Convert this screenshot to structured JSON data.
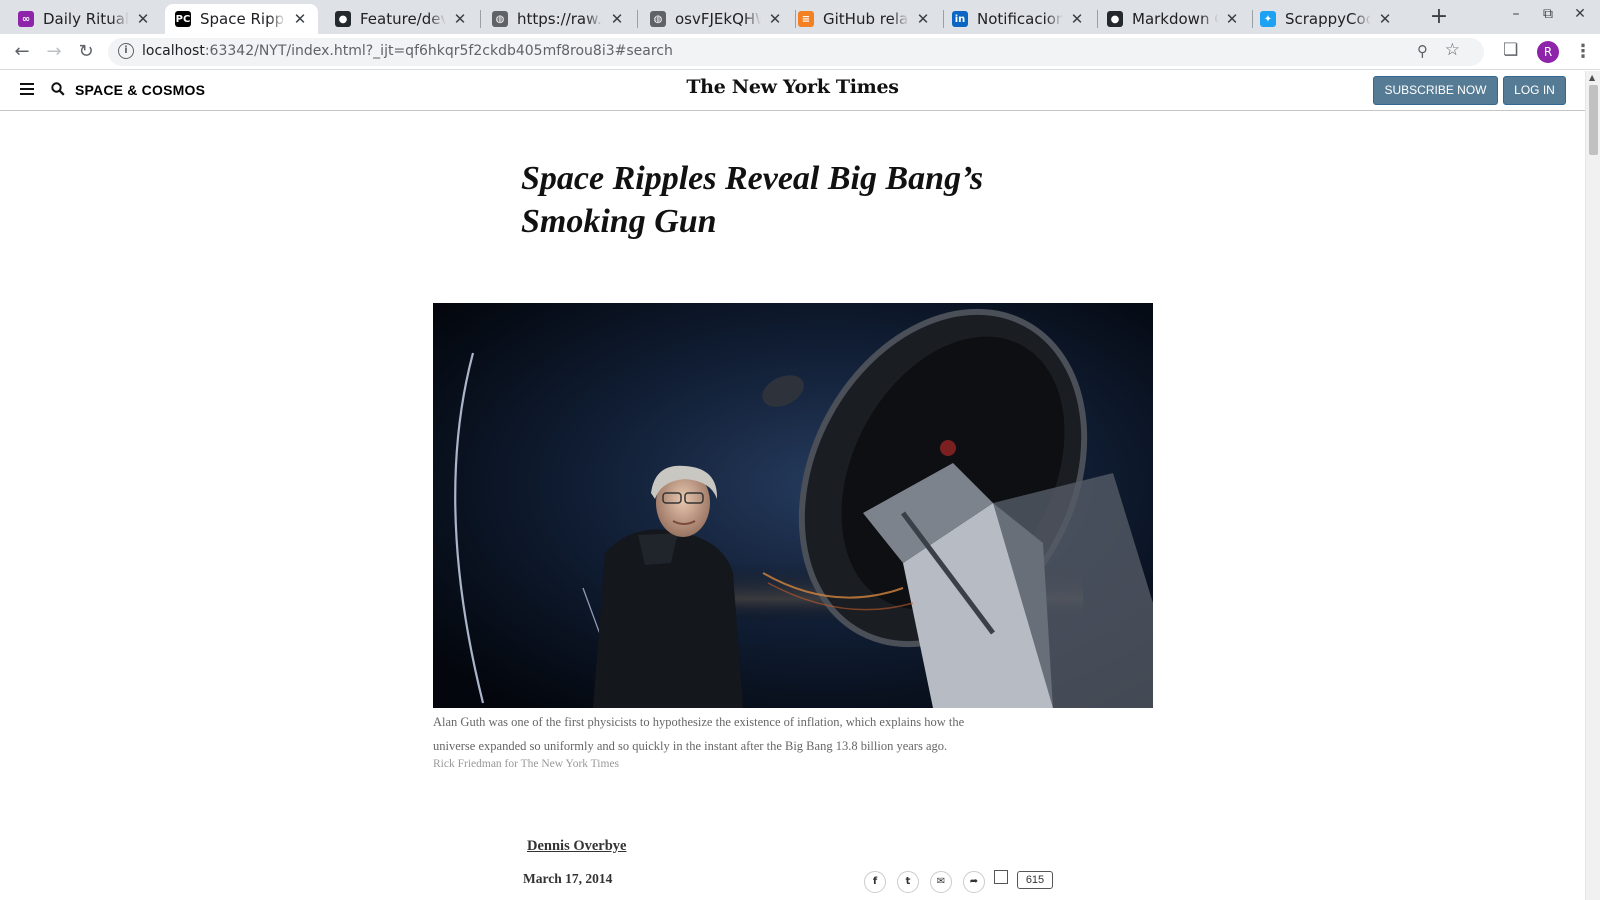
{
  "browser": {
    "tabs": [
      {
        "title": "Daily Rituals",
        "icon": "habit-app-icon",
        "color": "#8e24aa"
      },
      {
        "title": "Space Ripples Reveal Big Bang's Smoking Gun",
        "icon": "pycharm-icon",
        "color": "#000000",
        "active": true
      },
      {
        "title": "Feature/develop",
        "icon": "github-error-icon",
        "color": "#24292e"
      },
      {
        "title": "https://raw.githubusercontent.com",
        "icon": "globe-icon",
        "color": "#5f6368"
      },
      {
        "title": "osvFJEkQHW",
        "icon": "globe-icon",
        "color": "#5f6368"
      },
      {
        "title": "GitHub relative",
        "icon": "stackoverflow-icon",
        "color": "#f48024"
      },
      {
        "title": "Notificaciones",
        "icon": "linkedin-icon",
        "color": "#0a66c2"
      },
      {
        "title": "Markdown Cheatsheet",
        "icon": "github-icon",
        "color": "#24292e"
      },
      {
        "title": "ScrappyCoco",
        "icon": "twitter-icon",
        "color": "#1da1f2"
      }
    ],
    "url_host": "localhost",
    "url_rest": ":63342/NYT/index.html?_ijt=qf6hkqr5f2ckdb405mf8rou8i3#search",
    "profile_initial": "R"
  },
  "header": {
    "section": "SPACE & COSMOS",
    "masthead": "The New York Times",
    "subscribe": "SUBSCRIBE NOW",
    "login": "LOG IN"
  },
  "article": {
    "headline": "Space Ripples Reveal Big Bang’s Smoking Gun",
    "caption": "Alan Guth was one of the first physicists to hypothesize the existence of inflation, which explains how the universe expanded so uniformly and so quickly in the instant after the Big Bang 13.8 billion years ago.",
    "credit": "Rick Friedman for The New York Times",
    "author": "Dennis Overbye",
    "date": "March 17, 2014",
    "comment_count": "615"
  },
  "colors": {
    "button_bg": "#567b95",
    "tabbar_bg": "#dee1e6"
  }
}
